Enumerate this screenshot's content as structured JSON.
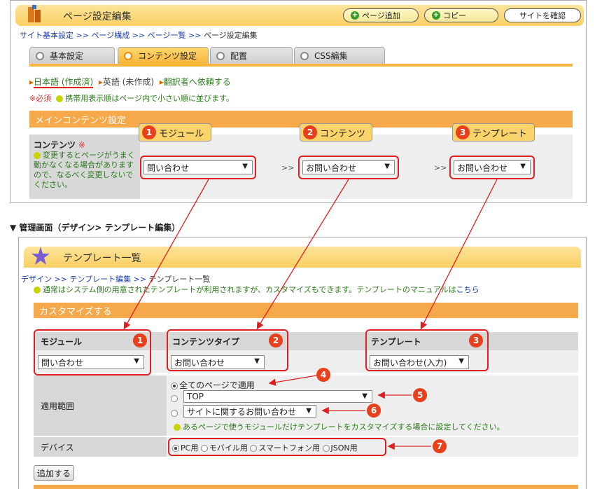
{
  "top": {
    "title": "ページ設定編集",
    "buttons": {
      "add_page": "ページ追加",
      "copy": "コピー",
      "check_site": "サイトを確認"
    },
    "breadcrumb": [
      "サイト基本設定",
      "ページ構成",
      "ページ一覧",
      "ページ設定編集"
    ],
    "breadcrumb_sep": ">>",
    "tabs": [
      "基本設定",
      "コンテンツ設定",
      "配置",
      "CSS編集"
    ],
    "languages": [
      "日本語 (作成済)",
      "英語 (未作成)",
      "翻訳者へ依頼する"
    ],
    "required_note": "※必須",
    "mobile_note": "携帯用表示順はページ内で小さい順に並びます。",
    "section_title": "メインコンテンツ設定",
    "row_label": "コンテンツ",
    "row_required_mark": "※",
    "row_note": "変更するとページがうまく動かなくなる場合がありますので、なるべく変更しないでください。",
    "selects": [
      "問い合わせ",
      "お問い合わせ",
      "お問い合わせ"
    ],
    "sep": ">>",
    "callouts": [
      {
        "num": "1",
        "label": "モジュール"
      },
      {
        "num": "2",
        "label": "コンテンツ"
      },
      {
        "num": "3",
        "label": "テンプレート"
      }
    ]
  },
  "heading": "▼ 管理画面（デザイン> テンプレート編集）",
  "bottom": {
    "title": "テンプレート一覧",
    "breadcrumb": [
      "デザイン",
      "テンプレート編集",
      "テンプレート一覧"
    ],
    "breadcrumb_sep": ">>",
    "info_text": "通常はシステム側の用意されたテンプレートが利用されますが、カスタマイズもできます。テンプレートのマニュアルは",
    "info_link": "こちら",
    "section_title": "カスタマイズする",
    "headers": [
      {
        "label": "モジュール",
        "num": "1"
      },
      {
        "label": "コンテンツタイプ",
        "num": "2"
      },
      {
        "label": "テンプレート",
        "num": "3"
      }
    ],
    "selects": [
      "問い合わせ",
      "お問い合わせ",
      "お問い合わせ(入力)"
    ],
    "scope_label": "適用範囲",
    "scope_all": "全てのページで適用",
    "scope_top": "TOP",
    "scope_site": "サイトに関するお問い合わせ",
    "scope_note": "あるページで使うモジュールだけテンプレートをカスタマイズする場合に設定してください。",
    "device_label": "デバイス",
    "devices": [
      "PC用",
      "モバイル用",
      "スマートフォン用",
      "JSON用"
    ],
    "add_button": "追加する",
    "badges": [
      "4",
      "5",
      "6",
      "7"
    ]
  },
  "colors": {
    "accent_red": "#e02020",
    "section_orange": "#f6a94b",
    "title_yellow": "#f9cf63",
    "link_blue": "#1a3ea8"
  }
}
